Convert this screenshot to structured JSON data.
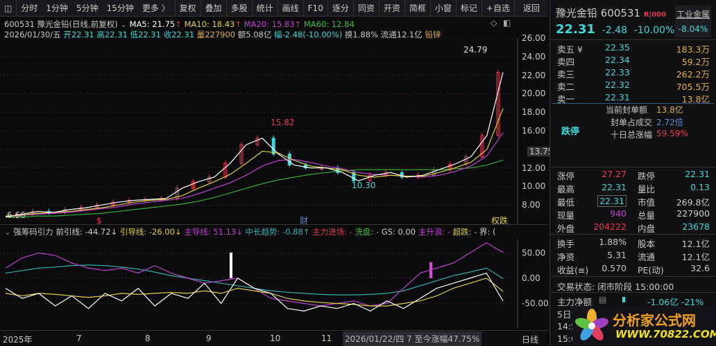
{
  "toolbar": {
    "items": [
      "分时",
      "1分钟",
      "5分钟",
      "15分钟",
      "更多 〉"
    ],
    "buttons": [
      "复权",
      "叠加",
      "多股",
      "统计",
      "画线",
      "F10",
      "逐分",
      "同资",
      "开资",
      "简框",
      "小窗",
      "标记",
      "+自选",
      "返回"
    ]
  },
  "header": {
    "title": "600531 豫光金铅(日线,前复权)",
    "ma5": "MA5: 21.75",
    "ma10": "MA10: 18.43",
    "ma20": "MA20: 15.83",
    "ma60": "MA60: 12.84",
    "date": "2026/01/30/五",
    "open": "开22.31",
    "high": "高22.31",
    "low": "低22.31",
    "close": "收22.31",
    "vol": "量227900",
    "amt": "额5.08亿",
    "chg": "幅-2.48(-10.00%)",
    "turn": "换1.88%",
    "float": "流通12.1亿",
    "sector": "铅锌"
  },
  "price_axis": [
    "26.00",
    "24.00",
    "22.00",
    "20.00",
    "18.00",
    "16.00",
    "13.75",
    "12.00",
    "10.00",
    "8.00"
  ],
  "annotations": {
    "high": "15.82",
    "low": "10.30",
    "latest_high": "24.79",
    "start": "6.66",
    "s_mark": "$",
    "cai_mark": "财",
    "tag": "权跌"
  },
  "indicator": {
    "name": "强筹码引力",
    "qyx": "前引线: -44.72↓",
    "ydx": "引导线: -26.00↓",
    "zdx": "主导线: 51.13↓",
    "zcqs": "中长趋势: -0.88↑",
    "zljc": "主力进场: -",
    "xp": "洗盘: -",
    "gs": "GS: 0.00",
    "zsl": "主升浪: -",
    "cd": "超跌: -",
    "jie": "界: (",
    "axis": [
      "50.00",
      "0.00",
      "-50.00"
    ]
  },
  "xaxis": {
    "labels": [
      "2025年",
      "7",
      "8",
      "9",
      "10",
      "11"
    ],
    "cursor": "2026/01/22/四 7 至今涨幅47.75%",
    "period": "日线"
  },
  "chart_data": {
    "type": "line",
    "close": [
      6.7,
      7.0,
      7.3,
      7.2,
      7.5,
      7.7,
      8.0,
      8.3,
      8.5,
      8.6,
      8.7,
      9.8,
      10.5,
      11.0,
      12.5,
      14.5,
      15.2,
      13.5,
      12.3,
      12.0,
      12.0,
      11.5,
      10.6,
      11.2,
      11.5,
      11.0,
      11.2,
      11.8,
      12.4,
      13.2,
      15.5,
      22.3
    ],
    "ma10": [
      6.8,
      6.9,
      7.1,
      7.2,
      7.3,
      7.5,
      7.7,
      8.0,
      8.3,
      8.5,
      8.6,
      9.0,
      9.8,
      10.5,
      11.3,
      12.5,
      13.8,
      13.6,
      12.8,
      12.2,
      12.0,
      11.8,
      11.2,
      11.0,
      11.2,
      11.1,
      11.1,
      11.5,
      12.0,
      12.6,
      14.0,
      18.4
    ],
    "ma20": [
      6.8,
      6.9,
      7.0,
      7.1,
      7.2,
      7.4,
      7.6,
      7.8,
      8.1,
      8.3,
      8.5,
      8.7,
      9.2,
      9.8,
      10.4,
      11.2,
      12.2,
      12.8,
      12.9,
      12.6,
      12.2,
      11.9,
      11.5,
      11.3,
      11.2,
      11.1,
      11.0,
      11.2,
      11.6,
      12.2,
      13.3,
      15.8
    ],
    "ma60": [
      6.7,
      6.7,
      6.8,
      6.8,
      6.9,
      7.0,
      7.1,
      7.3,
      7.5,
      7.7,
      7.9,
      8.1,
      8.4,
      8.8,
      9.3,
      9.8,
      10.3,
      10.7,
      11.0,
      11.3,
      11.5,
      11.7,
      11.8,
      11.8,
      11.8,
      11.8,
      11.8,
      11.8,
      11.9,
      12.0,
      12.3,
      12.84
    ],
    "ylim": [
      6,
      26
    ],
    "ind_white": [
      -20,
      -40,
      -30,
      -55,
      -35,
      -60,
      -30,
      -45,
      -20,
      -55,
      -30,
      -40,
      -10,
      -50,
      0,
      -20,
      -30,
      -60,
      -65,
      -55,
      -60,
      -50,
      -65,
      -45,
      -60,
      -40,
      -20,
      -10,
      0,
      10,
      -44.72
    ],
    "ind_yellow": [
      -30,
      -35,
      -30,
      -32,
      -35,
      -38,
      -35,
      -30,
      -32,
      -30,
      -28,
      -30,
      -25,
      -30,
      -20,
      -25,
      -30,
      -40,
      -45,
      -48,
      -50,
      -52,
      -55,
      -55,
      -50,
      -45,
      -35,
      -20,
      -10,
      0,
      -26
    ],
    "ind_magenta": [
      20,
      40,
      50,
      45,
      30,
      20,
      15,
      20,
      10,
      25,
      10,
      0,
      -10,
      -5,
      0,
      -20,
      -40,
      -45,
      -50,
      -55,
      -50,
      -45,
      -55,
      -50,
      -20,
      10,
      20,
      30,
      50,
      70,
      51.13
    ],
    "ind_cyan": [
      10,
      15,
      20,
      22,
      25,
      26,
      25,
      22,
      18,
      12,
      5,
      0,
      -5,
      -10,
      -15,
      -20,
      -25,
      -28,
      -30,
      -32,
      -33,
      -33,
      -32,
      -30,
      -25,
      -15,
      -5,
      5,
      12,
      20,
      -0.88
    ],
    "ind_ylim": [
      -75,
      75
    ]
  },
  "quote": {
    "name": "豫光金铅",
    "code": "600531",
    "badge": "R|000",
    "price": "22.31",
    "chg": "-2.48",
    "pct": "-10.00%",
    "sector": "工业金属",
    "sector_pct": "-8.04%"
  },
  "asks": [
    {
      "l": "卖五 ¥",
      "p": "22.35",
      "v": "183.3万"
    },
    {
      "l": "卖四",
      "p": "22.34",
      "v": "59.2万"
    },
    {
      "l": "卖三",
      "p": "22.33",
      "v": "262.2万"
    },
    {
      "l": "卖二",
      "p": "22.32",
      "v": "705.5万"
    },
    {
      "l": "卖一",
      "p": "22.31",
      "v": "13.8亿"
    }
  ],
  "seal": {
    "status": "跌停",
    "amt_l": "当前封单额",
    "amt": "13.8亿",
    "ratio_l": "封单占成交",
    "ratio": "2.72倍",
    "ten_l": "十日总涨幅",
    "ten": "59.59%"
  },
  "stats": [
    [
      "涨停",
      "27.27",
      "跌停",
      "22.31"
    ],
    [
      "最高",
      "22.31",
      "量比",
      "0.13"
    ],
    [
      "最低",
      "22.31",
      "市值",
      "269.8亿"
    ],
    [
      "现量",
      "940",
      "总量",
      "227900"
    ],
    [
      "外盘",
      "204222",
      "内盘",
      "23678"
    ]
  ],
  "stats2": [
    [
      "换手",
      "1.88%",
      "股本",
      "12.1亿"
    ],
    [
      "净资",
      "5.31",
      "流通",
      "12.1亿"
    ],
    [
      "收益(≡)",
      "0.570",
      "PE(动)",
      "32.6"
    ]
  ],
  "trade": {
    "state": "交易状态: 闭市阶段 15:00:00",
    "flow_l": "主力净额",
    "flow": "-1.06亿 -21%",
    "d5": "5日",
    "t1": "14:5",
    "t2": "15:0"
  },
  "logo": {
    "text": "分析家公式网",
    "url": "WWW.70822.COM"
  },
  "colors": {
    "up": "#e8384f",
    "down": "#3fd8d8",
    "ma5": "#ffffff",
    "ma10": "#e0d040",
    "ma20": "#c040d0",
    "ma60": "#30b030"
  }
}
